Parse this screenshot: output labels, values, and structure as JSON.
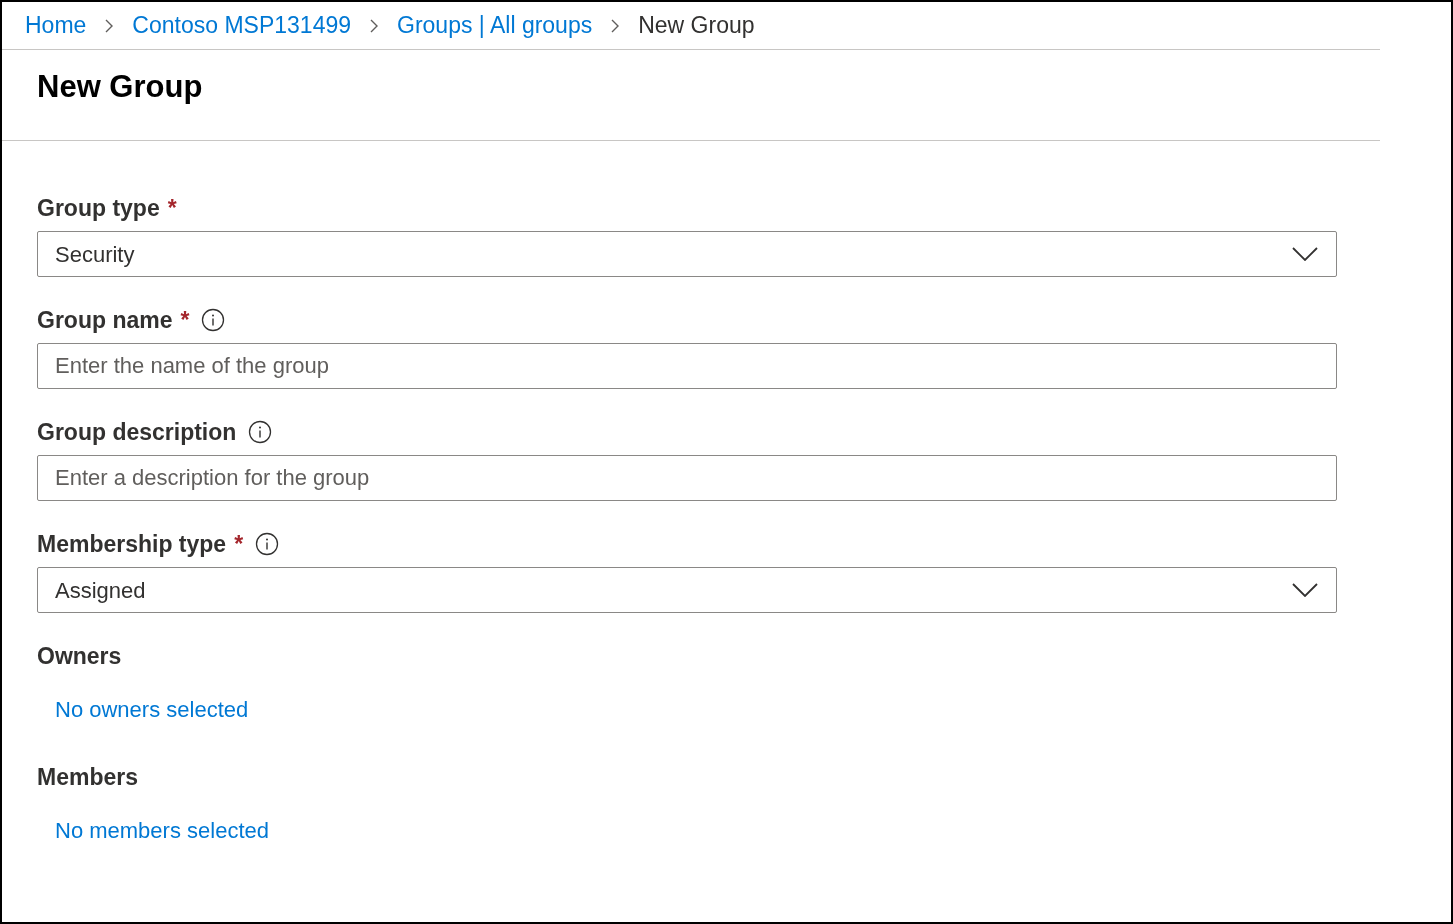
{
  "breadcrumb": [
    {
      "label": "Home",
      "kind": "link"
    },
    {
      "label": "Contoso MSP131499",
      "kind": "link"
    },
    {
      "label": "Groups | All groups",
      "kind": "link"
    },
    {
      "label": "New Group",
      "kind": "current"
    }
  ],
  "title": "New Group",
  "fields": [
    {
      "kind": "dropdown",
      "label": "Group type",
      "required_mark": "*",
      "info": false,
      "value": "Security"
    },
    {
      "kind": "text",
      "label": "Group name",
      "required_mark": "*",
      "info": true,
      "placeholder": "Enter the name of the group"
    },
    {
      "kind": "text",
      "label": "Group description",
      "info": true,
      "placeholder": "Enter a description for the group"
    },
    {
      "kind": "dropdown",
      "label": "Membership type",
      "required_mark": "*",
      "info": true,
      "value": "Assigned"
    },
    {
      "kind": "picker",
      "label": "Owners",
      "info": false,
      "link": "No owners selected"
    },
    {
      "kind": "picker",
      "label": "Members",
      "info": false,
      "link": "No members selected"
    }
  ]
}
